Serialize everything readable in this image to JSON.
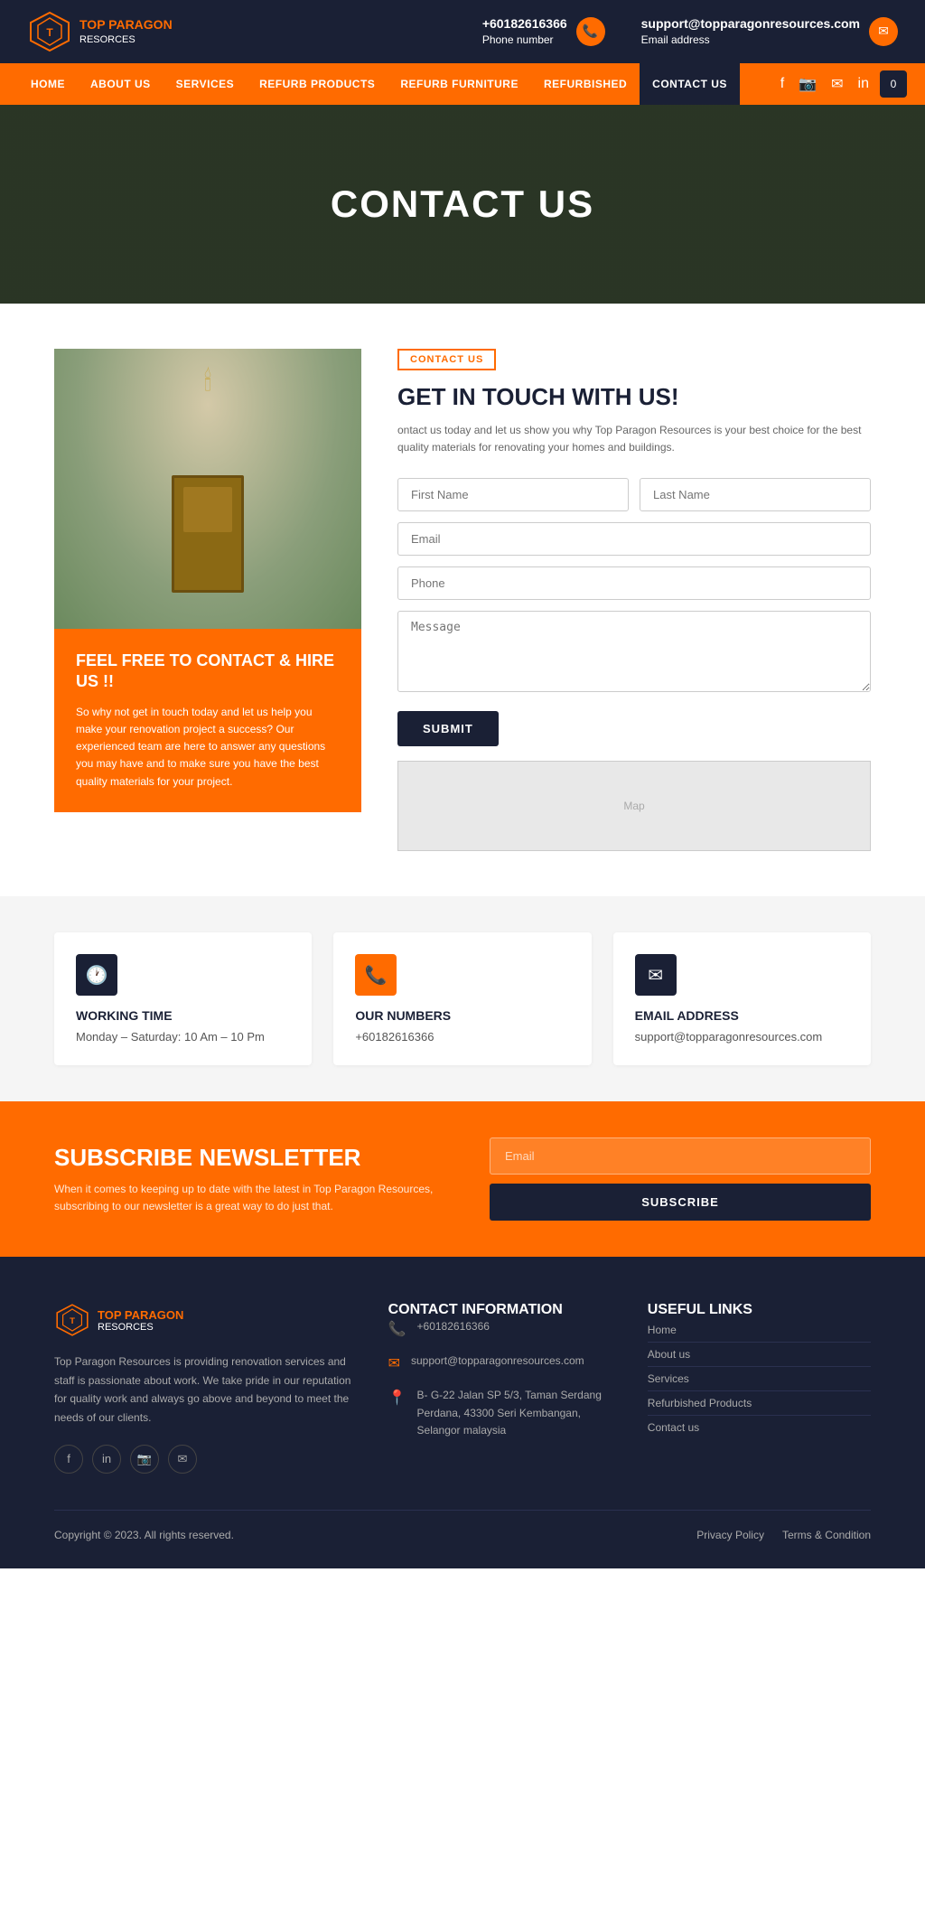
{
  "topbar": {
    "logo_brand": "TOP PARAGON",
    "logo_sub": "RESORCES",
    "phone": "+60182616366",
    "phone_label": "Phone number",
    "email": "support@topparagonresources.com",
    "email_label": "Email address"
  },
  "nav": {
    "items": [
      {
        "label": "HOME",
        "active": false
      },
      {
        "label": "ABOUT US",
        "active": false
      },
      {
        "label": "SERVICES",
        "active": false
      },
      {
        "label": "REFURB PRODUCTS",
        "active": false
      },
      {
        "label": "REFURB FURNITURE",
        "active": false
      },
      {
        "label": "REFURBISHED",
        "active": false
      },
      {
        "label": "CONTACT US",
        "active": true
      }
    ]
  },
  "hero": {
    "title": "CONTACT US"
  },
  "contact_section": {
    "badge": "CONTACT US",
    "title": "GET IN TOUCH WITH US!",
    "description": "ontact us today and let us show you why Top Paragon Resources is your best choice for the best quality materials for renovating your homes and buildings.",
    "orange_box_title": "FEEL FREE TO CONTACT & HIRE US !!",
    "orange_box_text": "So why not get in touch today and let us help you make your renovation project a success? Our experienced team are here to answer any questions you may have and to make sure you have the best quality materials for your project.",
    "form": {
      "first_name_placeholder": "First Name",
      "last_name_placeholder": "Last Name",
      "email_placeholder": "Email",
      "phone_placeholder": "Phone",
      "message_placeholder": "Message",
      "submit_label": "SUBMIT"
    }
  },
  "info_cards": [
    {
      "icon": "🕐",
      "icon_type": "dark",
      "title": "WORKING TIME",
      "text": "Monday – Saturday: 10 Am – 10 Pm"
    },
    {
      "icon": "📞",
      "icon_type": "orange",
      "title": "OUR NUMBERS",
      "text": "+60182616366"
    },
    {
      "icon": "✉",
      "icon_type": "dark",
      "title": "EMAIL ADDRESS",
      "text": "support@topparagonresources.com"
    }
  ],
  "newsletter": {
    "title": "SUBSCRIBE NEWSLETTER",
    "description": "When it comes to keeping up to date with the latest in Top Paragon Resources, subscribing to our newsletter is a great way to do just that.",
    "email_placeholder": "Email",
    "subscribe_label": "SUBSCRIBE"
  },
  "footer": {
    "logo_brand": "TOP PARAGON",
    "logo_sub": "RESORCES",
    "description": "Top Paragon Resources is providing renovation services and staff is passionate about work. We take pride in our reputation for quality work and always go above and beyond to meet the needs of our clients.",
    "contact_info_title": "CONTACT INFORMATION",
    "phone": "+60182616366",
    "email": "support@topparagonresources.com",
    "address": "B- G-22 Jalan SP 5/3, Taman Serdang Perdana, 43300 Seri Kembangan, Selangor malaysia",
    "useful_links_title": "USEFUL LINKS",
    "links": [
      {
        "label": "Home"
      },
      {
        "label": "About us"
      },
      {
        "label": "Services"
      },
      {
        "label": "Refurbished Products"
      },
      {
        "label": "Contact us"
      }
    ],
    "copyright": "Copyright © 2023. All rights reserved.",
    "privacy_policy": "Privacy Policy",
    "terms": "Terms & Condition"
  }
}
